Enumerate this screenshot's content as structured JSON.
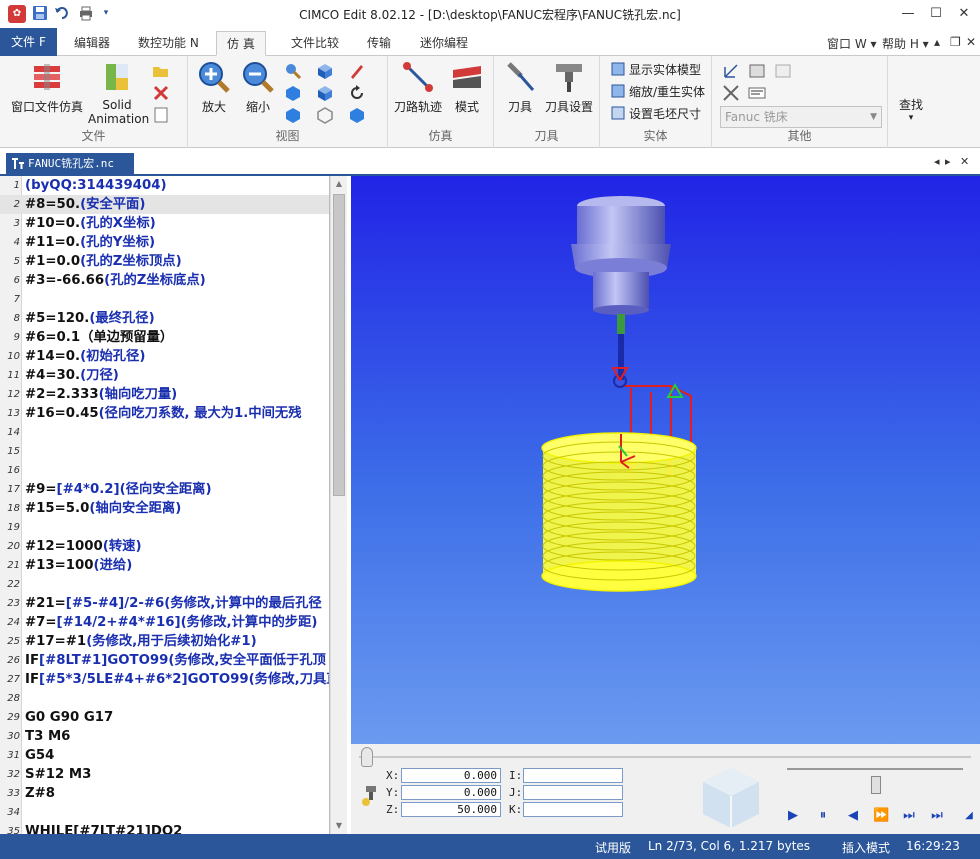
{
  "titlebar": {
    "title": "CIMCO Edit 8.02.12 - [D:\\desktop\\FANUC宏程序\\FANUC铣孔宏.nc]",
    "app_icon": "cimco-logo-icon"
  },
  "ribbon_tabs": {
    "file": "文件 F",
    "items": [
      "编辑器",
      "数控功能 N",
      "仿 真",
      "文件比较",
      "传输",
      "迷你编程"
    ],
    "active_index": 2,
    "right_window": "窗口 W",
    "right_help": "帮助 H"
  },
  "groups": {
    "file": {
      "label": "文件",
      "window_sim": "窗口文件仿真",
      "solid_line1": "Solid",
      "solid_line2": "Animation"
    },
    "view": {
      "label": "视图",
      "zoom_in": "放大",
      "zoom_out": "缩小"
    },
    "sim": {
      "label": "仿真",
      "toolpath": "刀路轨迹",
      "mode": "模式"
    },
    "tool": {
      "label": "刀具",
      "tool": "刀具",
      "tool_setup": "刀具设置"
    },
    "solid": {
      "label": "实体",
      "show_model": "显示实体模型",
      "zoom_regen": "缩放/重生实体",
      "set_stock": "设置毛坯尺寸"
    },
    "other": {
      "label": "其他",
      "machine": "Fanuc 铣床"
    },
    "find": {
      "label": "查找"
    }
  },
  "document": {
    "tab_label": "FANUC铣孔宏.nc"
  },
  "editor": {
    "lines": [
      {
        "no": "1",
        "code": "(byQQ:314439404)",
        "color": "blue"
      },
      {
        "no": "2",
        "code": "#8=50.(安全平面)",
        "color": "mixed",
        "hl": true
      },
      {
        "no": "3",
        "code": "#10=0.(孔的X坐标)",
        "color": "mixed"
      },
      {
        "no": "4",
        "code": "#11=0.(孔的Y坐标)",
        "color": "mixed"
      },
      {
        "no": "5",
        "code": "#1=0.0(孔的Z坐标顶点)",
        "color": "mixed"
      },
      {
        "no": "6",
        "code": "#3=-66.66(孔的Z坐标底点)",
        "color": "mixed"
      },
      {
        "no": "7",
        "code": "",
        "color": "black"
      },
      {
        "no": "8",
        "code": "#5=120.(最终孔径)",
        "color": "mixed"
      },
      {
        "no": "9",
        "code": "#6=0.1（单边预留量）",
        "color": "black"
      },
      {
        "no": "10",
        "code": "#14=0.(初始孔径)",
        "color": "mixed"
      },
      {
        "no": "11",
        "code": "#4=30.(刀径)",
        "color": "mixed"
      },
      {
        "no": "12",
        "code": "#2=2.333(轴向吃刀量)",
        "color": "mixed"
      },
      {
        "no": "13",
        "code": "#16=0.45(径向吃刀系数, 最大为1.中间无残",
        "color": "mixed"
      },
      {
        "no": "14",
        "code": "",
        "color": "black"
      },
      {
        "no": "15",
        "code": "",
        "color": "black"
      },
      {
        "no": "16",
        "code": "",
        "color": "black"
      },
      {
        "no": "17",
        "code": "#9=[#4*0.2](径向安全距离)",
        "color": "mixed"
      },
      {
        "no": "18",
        "code": "#15=5.0(轴向安全距离)",
        "color": "mixed"
      },
      {
        "no": "19",
        "code": "",
        "color": "black"
      },
      {
        "no": "20",
        "code": "#12=1000(转速)",
        "color": "mixed"
      },
      {
        "no": "21",
        "code": "#13=100(进给)",
        "color": "mixed"
      },
      {
        "no": "22",
        "code": "",
        "color": "black"
      },
      {
        "no": "23",
        "code": "#21=[#5-#4]/2-#6(务修改,计算中的最后孔径",
        "color": "mixed"
      },
      {
        "no": "24",
        "code": "#7=[#14/2+#4*#16](务修改,计算中的步距)",
        "color": "mixed"
      },
      {
        "no": "25",
        "code": "#17=#1(务修改,用于后续初始化#1)",
        "color": "mixed"
      },
      {
        "no": "26",
        "code": "IF[#8LT#1]GOTO99(务修改,安全平面低于孔顶",
        "color": "mixed"
      },
      {
        "no": "27",
        "code": "IF[#5*3/5LE#4+#6*2]GOTO99(务修改,刀具直",
        "color": "mixed"
      },
      {
        "no": "28",
        "code": "",
        "color": "black"
      },
      {
        "no": "29",
        "code": "G0 G90 G17",
        "color": "black"
      },
      {
        "no": "30",
        "code": "T3 M6",
        "color": "black"
      },
      {
        "no": "31",
        "code": "G54",
        "color": "black"
      },
      {
        "no": "32",
        "code": "S#12 M3",
        "color": "black"
      },
      {
        "no": "33",
        "code": "Z#8",
        "color": "black"
      },
      {
        "no": "34",
        "code": "",
        "color": "black"
      },
      {
        "no": "35",
        "code": "WHILE[#7LT#21]DO2",
        "color": "black"
      }
    ]
  },
  "coords": {
    "x_label": "X:",
    "x": "0.000",
    "y_label": "Y:",
    "y": "0.000",
    "z_label": "Z:",
    "z": "50.000",
    "i_label": "I:",
    "i": "",
    "j_label": "J:",
    "j": "",
    "k_label": "K:",
    "k": ""
  },
  "statusbar": {
    "mode": "试用版",
    "position": "Ln 2/73, Col 6, 1.217 bytes",
    "insert": "插入模式",
    "time": "16:29:23"
  },
  "colors": {
    "accent": "#2b579a",
    "code_blue": "#1a2fb0",
    "stock_yellow": "#ffff33",
    "viewport_bg": "#2f4be6"
  }
}
